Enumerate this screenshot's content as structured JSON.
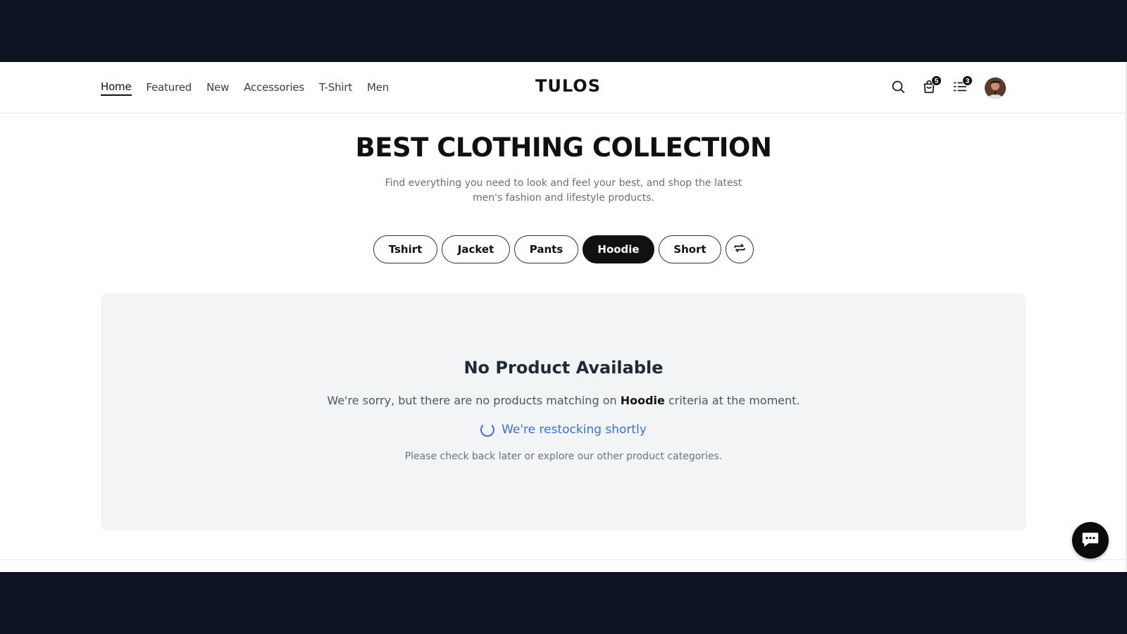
{
  "colors": {
    "frame": "#0d1321",
    "accent": "#111111",
    "link_blue": "#3a6fd8",
    "panel_bg": "#f3f4f6"
  },
  "nav": {
    "items": [
      {
        "label": "Home",
        "active": true
      },
      {
        "label": "Featured",
        "active": false
      },
      {
        "label": "New",
        "active": false
      },
      {
        "label": "Accessories",
        "active": false
      },
      {
        "label": "T-Shirt",
        "active": false
      },
      {
        "label": "Men",
        "active": false
      }
    ]
  },
  "brand": {
    "logo": "TULOS"
  },
  "header_icons": {
    "search": "search-icon",
    "cart": {
      "icon": "shopping-bag-icon",
      "count": "5"
    },
    "list": {
      "icon": "list-icon",
      "count": "3"
    },
    "avatar": "avatar"
  },
  "hero": {
    "title": "BEST CLOTHING COLLECTION",
    "subtitle": "Find everything you need to look and feel your best, and shop the latest men's fashion and lifestyle products."
  },
  "categories": {
    "items": [
      {
        "label": "Tshirt",
        "active": false
      },
      {
        "label": "Jacket",
        "active": false
      },
      {
        "label": "Pants",
        "active": false
      },
      {
        "label": "Hoodie",
        "active": true
      },
      {
        "label": "Short",
        "active": false
      }
    ],
    "swap_icon": "swap-arrows-icon"
  },
  "empty_state": {
    "title": "No Product Available",
    "message_prefix": "We're sorry, but there are no products matching on",
    "message_highlight": "Hoodie",
    "message_suffix": "criteria at the moment.",
    "restock": "We're restocking shortly",
    "note": "Please check back later or explore our other product categories."
  },
  "chat": {
    "icon": "chat-bubble-icon"
  }
}
